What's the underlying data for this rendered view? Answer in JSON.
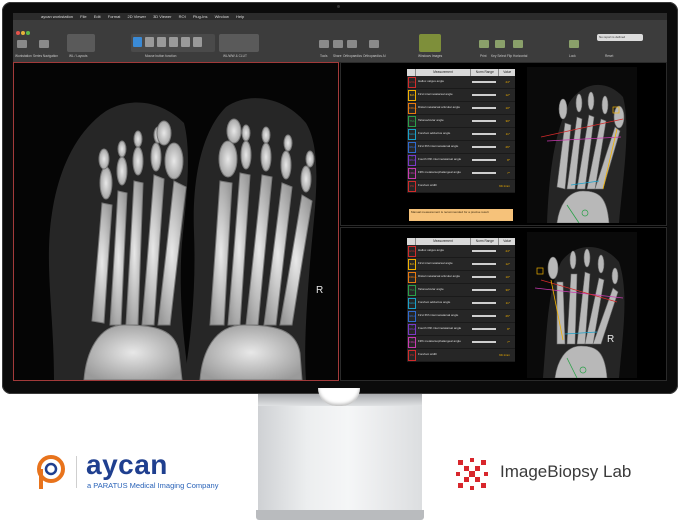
{
  "app": {
    "name": "aycan workstation",
    "menu": [
      "aycan workstation",
      "File",
      "Edit",
      "Format",
      "2D Viewer",
      "3D Viewer",
      "ROI",
      "Plug-Ins",
      "Window",
      "Help"
    ],
    "toolbar_labels": [
      "Workstation",
      "Series Navigation",
      "WL / Layouts",
      "Mouse button function",
      "WL/WW & CLUT",
      "Tools",
      "Share",
      "Orthopaedics",
      "Orthopaedics AI",
      "Windows Images",
      "Print",
      "Key Select",
      "Flip Horizontal",
      "Lock",
      "Reset",
      "No report is defined"
    ],
    "colors": {
      "accent": "#a23a3a",
      "window_bg": "#3c3c3c",
      "highlight": "#f0b000"
    }
  },
  "viewer": {
    "orientation_label": "R"
  },
  "measurements": {
    "headers": [
      "Measurement",
      "Norm Range",
      "Value"
    ],
    "rows": [
      {
        "code": "HVA",
        "name": "Hallux valgus angle",
        "value": "24°",
        "color": "#d12b2b"
      },
      {
        "code": "IMA",
        "name": "First intermetatarsal angle",
        "value": "12°",
        "color": "#f0b000"
      },
      {
        "code": "DMAA",
        "name": "Distal metatarsal articular angle",
        "value": "10°",
        "color": "#e87a10"
      },
      {
        "code": "TSA",
        "name": "Talonavicular angle",
        "value": "30°",
        "color": "#2aa048"
      },
      {
        "code": "MAA",
        "name": "Forefoot adductus angle",
        "value": "11°",
        "color": "#1aa0c8"
      },
      {
        "code": "IMA1-5",
        "name": "First fifth intermetatarsal angle",
        "value": "26°",
        "color": "#2f6ad0"
      },
      {
        "code": "IMA4-5",
        "name": "Fourth fifth intermetatarsal angle",
        "value": "8°",
        "color": "#7a3ac8"
      },
      {
        "code": "FMA",
        "name": "Fifth metatarsophalangeal angle",
        "value": "7°",
        "color": "#c83ab0"
      },
      {
        "code": "FW",
        "name": "Forefoot width",
        "value": "99.1mm",
        "color": "#d12b2b"
      }
    ],
    "note": "Manual measurement is recommended for a precise result"
  },
  "brands": {
    "aycan": {
      "name": "aycan",
      "sub": "a PARATUS Medical Imaging Company",
      "colors": {
        "orange": "#e8731c",
        "blue": "#1f3f8f"
      }
    },
    "iblab": {
      "name": "ImageBiopsy Lab",
      "colors": {
        "red": "#d8262c"
      }
    }
  }
}
